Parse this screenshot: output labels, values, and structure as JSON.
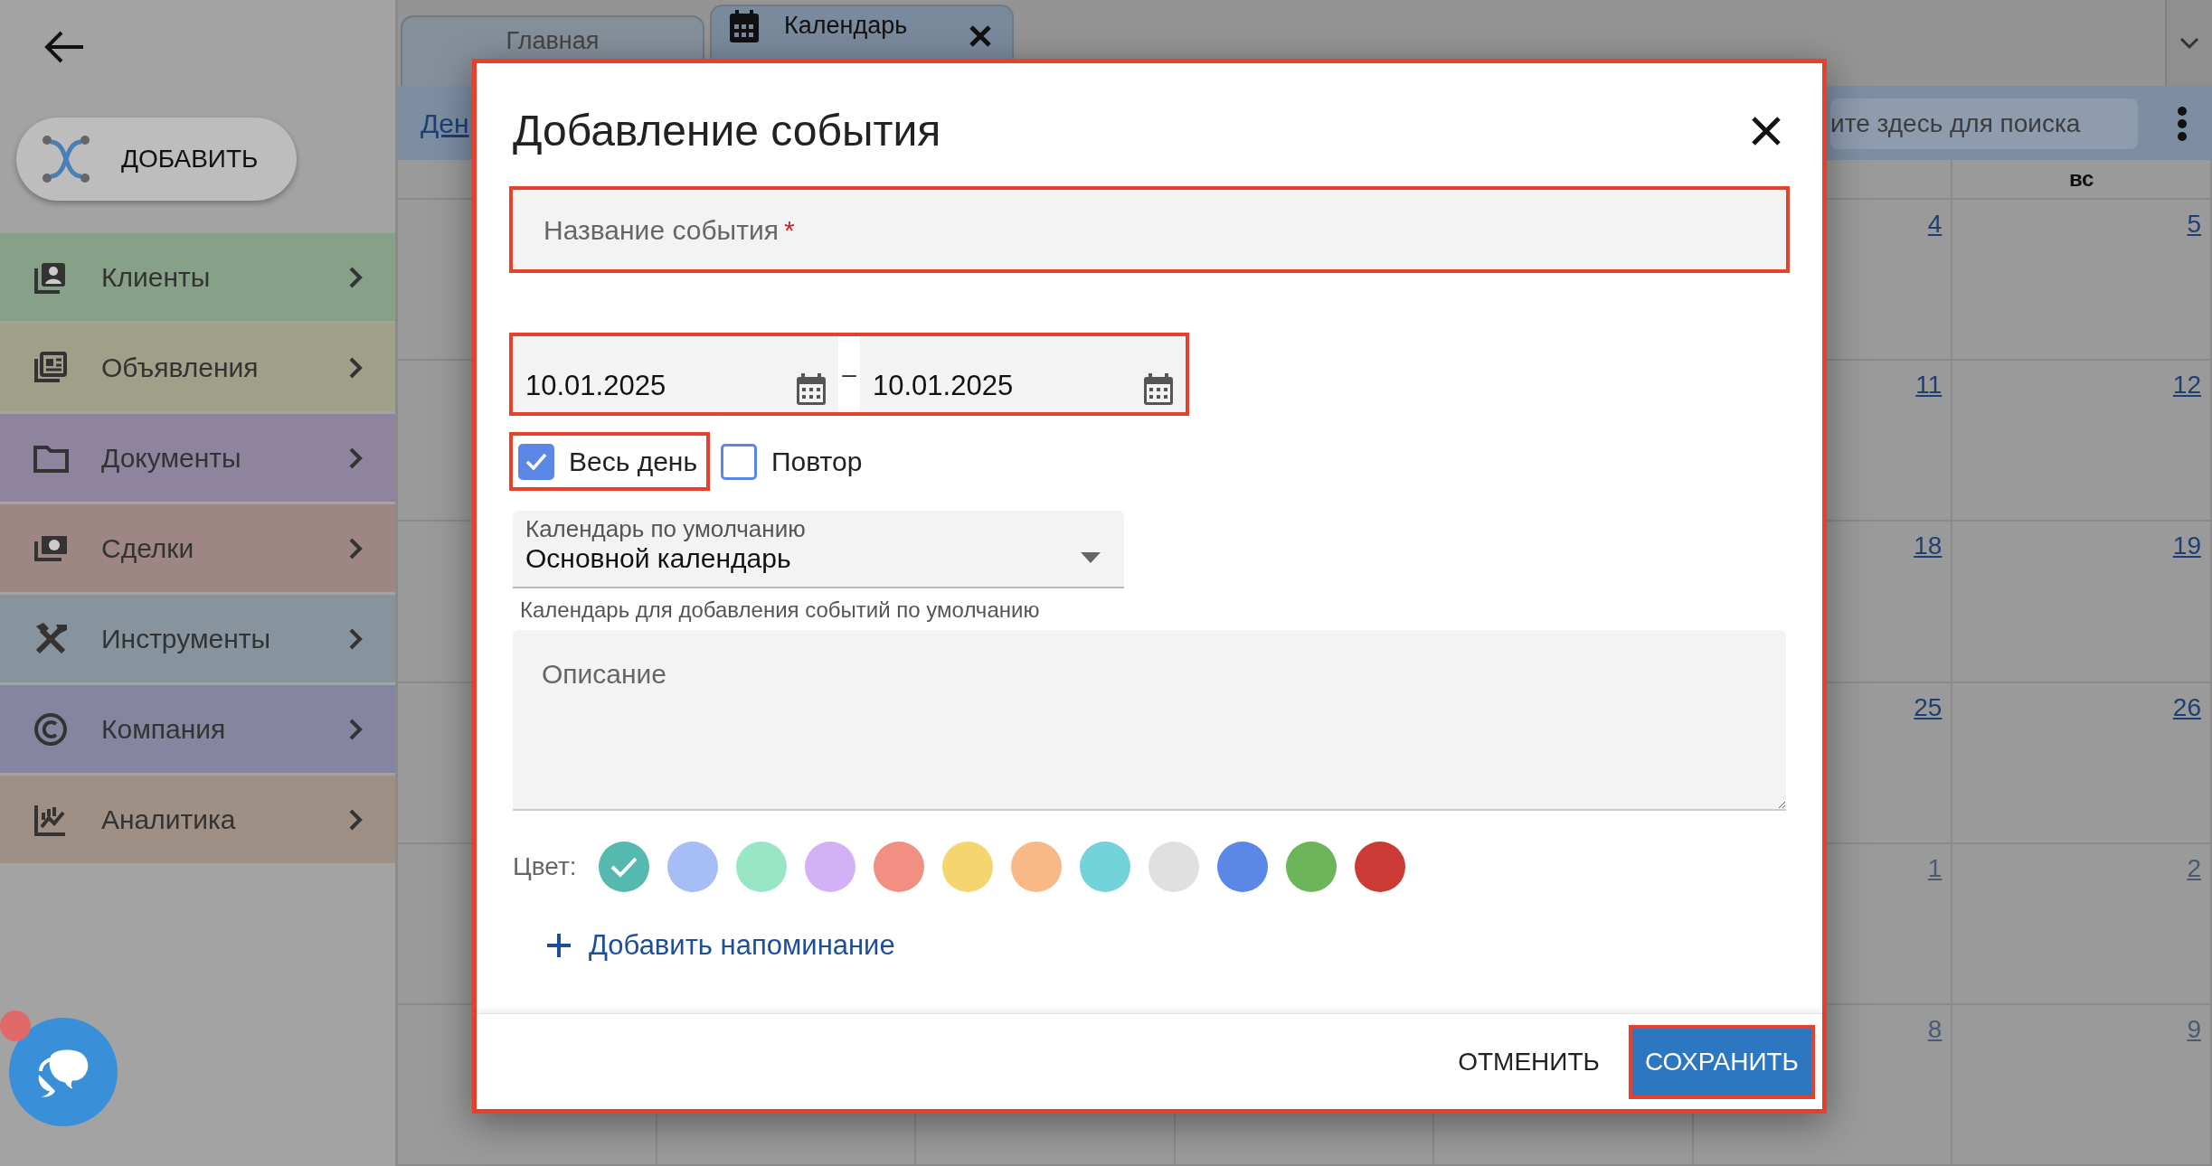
{
  "sidebar": {
    "add_button": "ДОБАВИТЬ",
    "items": [
      {
        "label": "Клиенты",
        "color": "#87a088"
      },
      {
        "label": "Объявления",
        "color": "#a09f87"
      },
      {
        "label": "Документы",
        "color": "#8e849e"
      },
      {
        "label": "Сделки",
        "color": "#9e8684"
      },
      {
        "label": "Инструменты",
        "color": "#87949e"
      },
      {
        "label": "Компания",
        "color": "#8585a0"
      },
      {
        "label": "Аналитика",
        "color": "#9e9084"
      }
    ],
    "chat": {
      "unread": true
    }
  },
  "tabs": [
    {
      "label": "Главная",
      "selected": false
    },
    {
      "label": "Календарь",
      "selected": true
    }
  ],
  "toolbar": {
    "view_link": "Ден",
    "search": {
      "placeholder": "ите здесь для поиска"
    }
  },
  "calendar": {
    "weekday": "вс",
    "weeks": [
      [
        {
          "day": "4",
          "other_month": false
        },
        {
          "day": "5",
          "other_month": false
        }
      ],
      [
        {
          "day": "11",
          "other_month": false
        },
        {
          "day": "12",
          "other_month": false
        }
      ],
      [
        {
          "day": "18",
          "other_month": false
        },
        {
          "day": "19",
          "other_month": false
        }
      ],
      [
        {
          "day": "25",
          "other_month": false
        },
        {
          "day": "26",
          "other_month": false
        }
      ],
      [
        {
          "day": "1",
          "other_month": true
        },
        {
          "day": "2",
          "other_month": true
        }
      ],
      [
        {
          "day": "8",
          "other_month": true
        },
        {
          "day": "9",
          "other_month": true
        }
      ]
    ]
  },
  "dialog": {
    "title": "Добавление события",
    "name_field": {
      "placeholder": "Название события",
      "required_mark": "*",
      "highlighted": true
    },
    "dates": {
      "highlighted": true,
      "separator": "–",
      "values": [
        "10.01.2025",
        "10.01.2025"
      ]
    },
    "checkboxes": [
      {
        "label": "Весь день",
        "checked": true,
        "highlighted": true
      },
      {
        "label": "Повтор",
        "checked": false,
        "highlighted": false
      }
    ],
    "calendar_select": {
      "label": "Календарь по умолчанию",
      "value": "Основной календарь",
      "hint": "Календарь для добавления событий по умолчанию"
    },
    "description": {
      "placeholder": "Описание"
    },
    "color_label": "Цвет:",
    "colors": [
      {
        "color": "#55b9b0",
        "selected": true
      },
      {
        "color": "#a7bdf5",
        "selected": false
      },
      {
        "color": "#98e6c6",
        "selected": false
      },
      {
        "color": "#d3b1f7",
        "selected": false
      },
      {
        "color": "#f28f83",
        "selected": false
      },
      {
        "color": "#f5d56e",
        "selected": false
      },
      {
        "color": "#f6b987",
        "selected": false
      },
      {
        "color": "#72d3d9",
        "selected": false
      },
      {
        "color": "#e0e0e0",
        "selected": false
      },
      {
        "color": "#5b88e6",
        "selected": false
      },
      {
        "color": "#6cb55a",
        "selected": false
      },
      {
        "color": "#cb3a34",
        "selected": false
      }
    ],
    "reminder_link": "Добавить напоминание",
    "buttons": [
      {
        "label": "ОТМЕНИТЬ",
        "kind": "text",
        "highlighted": false
      },
      {
        "label": "СОХРАНИТЬ",
        "kind": "primary",
        "highlighted": true
      }
    ]
  }
}
